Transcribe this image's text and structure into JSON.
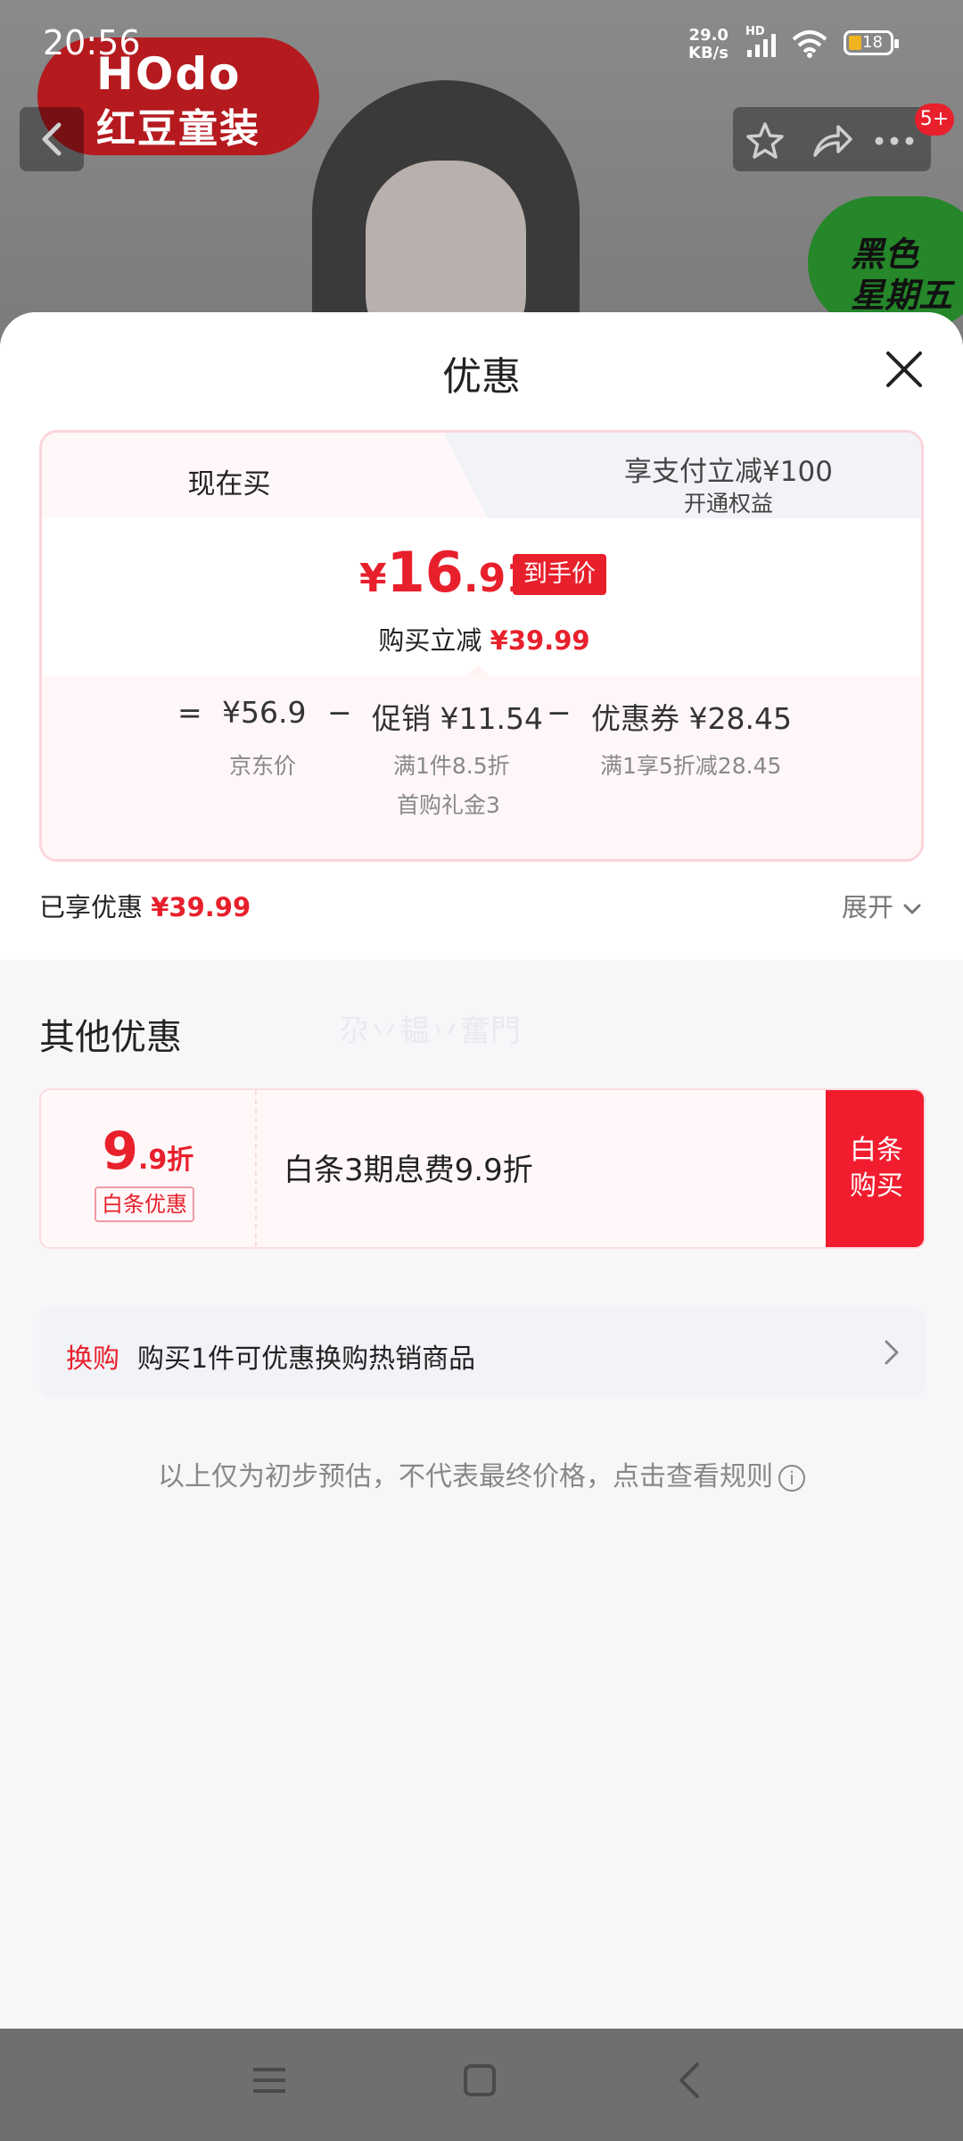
{
  "status_bar": {
    "time": "20:56",
    "speed_value": "29.0",
    "speed_unit": "KB/s",
    "hd": "HD",
    "battery": "18"
  },
  "background_page": {
    "brand_line1": "HOdo",
    "brand_line2": "红豆童装",
    "cart_badge": "5+",
    "promo_line1": "黑色",
    "promo_line2": "星期五"
  },
  "sheet": {
    "title": "优惠",
    "tabs": [
      {
        "label": "现在买"
      },
      {
        "line1": "享支付立减¥100",
        "line2": "开通权益"
      }
    ],
    "price": {
      "currency": "¥",
      "integer": "16",
      "decimal": ".91",
      "tag": "到手价",
      "save_label": "购买立减",
      "save_value": "¥39.99"
    },
    "breakdown": {
      "eq": "=",
      "base_value": "¥56.9",
      "base_label": "京东价",
      "minus": "−",
      "promo_value": "促销 ¥11.54",
      "promo_sub1": "满1件8.5折",
      "promo_sub2": "首购礼金3",
      "coupon_value": "优惠券 ¥28.45",
      "coupon_sub": "满1享5折减28.45"
    },
    "enjoyed_label": "已享优惠",
    "enjoyed_value": "¥39.99",
    "expand_label": "展开",
    "other_title": "其他优惠",
    "watermark": "尕丷韫丷奮門",
    "promo": {
      "value_big": "9",
      "value_small": ".9折",
      "tag": "白条优惠",
      "text": "白条3期息费9.9折",
      "button": "白条\n购买"
    },
    "swap": {
      "label": "换购",
      "text": "购买1件可优惠换购热销商品"
    },
    "disclaimer": "以上仅为初步预估，不代表最终价格，点击查看规则"
  },
  "colors": {
    "accent": "#e8202c",
    "card_border": "#fbd5da",
    "tab_bg": "#f2f3f7"
  }
}
